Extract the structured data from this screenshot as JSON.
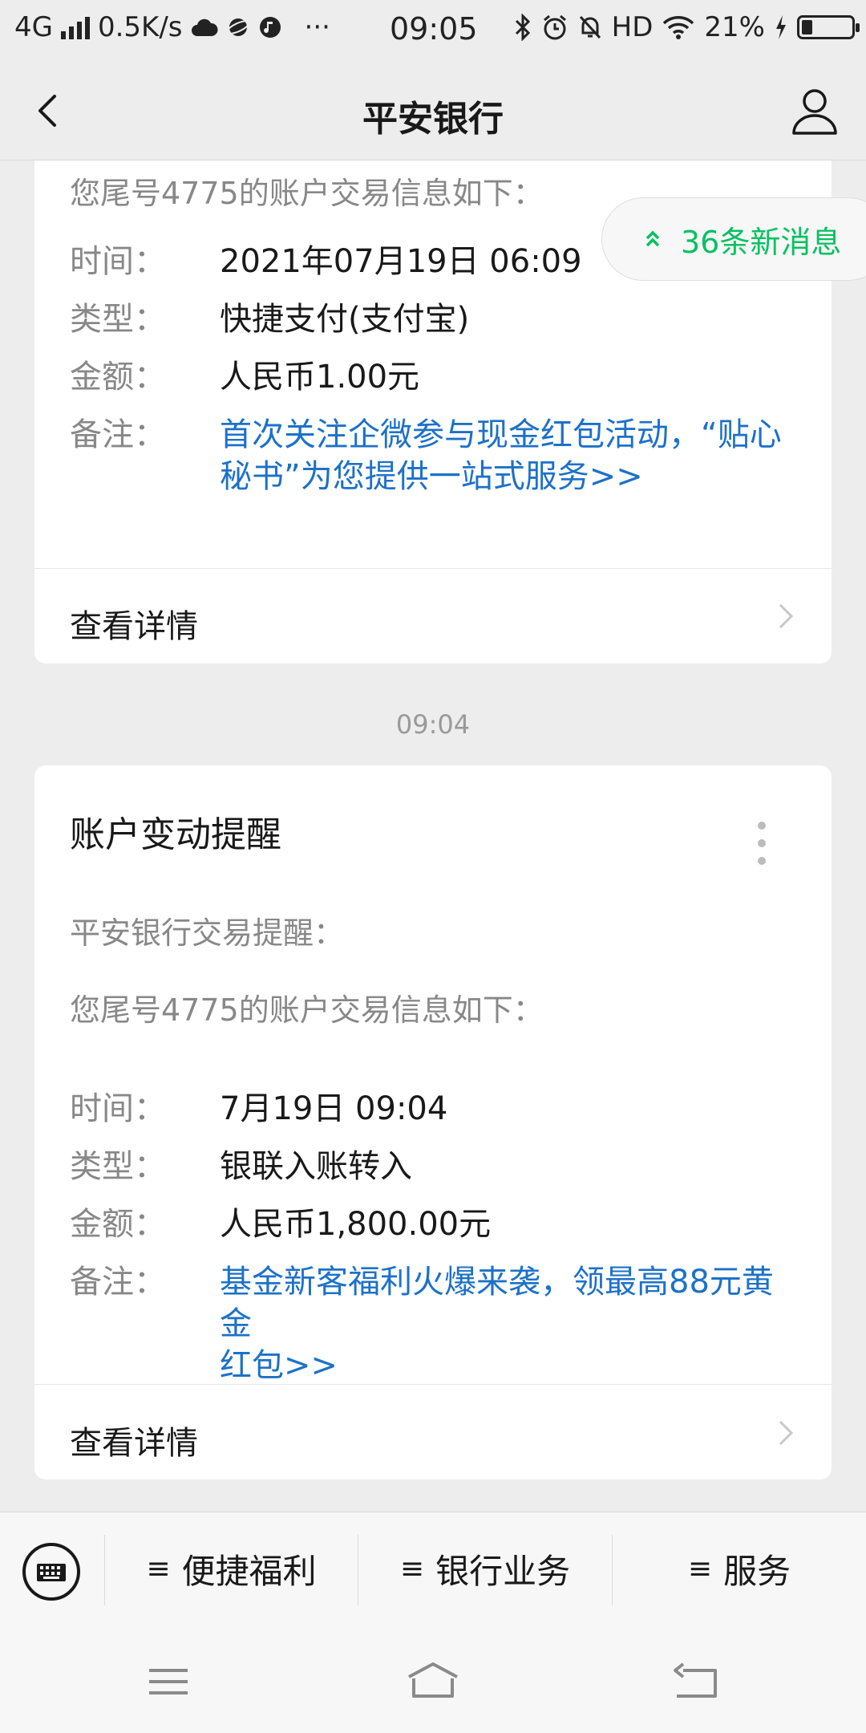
{
  "status_bar": {
    "network": "4G",
    "speed": "0.5K/s",
    "dots": "···",
    "time": "09:05",
    "hd": "HD",
    "battery_percent": "21%",
    "battery_level": 0.21
  },
  "header": {
    "title": "平安银行",
    "back_icon": "chevron-left-icon",
    "profile_icon": "person-icon"
  },
  "new_messages": {
    "label": "36条新消息",
    "icon": "double-chevron-up-icon",
    "color": "#07c160"
  },
  "messages": [
    {
      "intro": "您尾号4775的账户交易信息如下：",
      "rows": [
        {
          "label": "时间：",
          "value": "2021年07月19日 06:09"
        },
        {
          "label": "类型：",
          "value": "快捷支付(支付宝)"
        },
        {
          "label": "金额：",
          "value": "人民币1.00元"
        },
        {
          "label": "备注：",
          "value_line1": "首次关注企微参与现金红包活动，“贴心",
          "value_line2": "秘书”为您提供一站式服务>>"
        }
      ],
      "detail_label": "查看详情"
    },
    {
      "timestamp": "09:04",
      "title": "账户变动提醒",
      "greeting": "平安银行交易提醒：",
      "intro": "您尾号4775的账户交易信息如下：",
      "rows": [
        {
          "label": "时间：",
          "value": "7月19日 09:04"
        },
        {
          "label": "类型：",
          "value": "银联入账转入"
        },
        {
          "label": "金额：",
          "value": "人民币1,800.00元"
        },
        {
          "label": "备注：",
          "value_line1": "基金新客福利火爆来袭，领最高88元黄金",
          "value_line2": "红包>>"
        }
      ],
      "detail_label": "查看详情"
    }
  ],
  "bottom_menu": {
    "keyboard_icon": "keyboard-icon",
    "items": [
      {
        "label": "便捷福利",
        "prefix": "≡"
      },
      {
        "label": "银行业务",
        "prefix": "≡"
      },
      {
        "label": "服务",
        "prefix": "≡"
      }
    ]
  },
  "nav": {
    "menu_icon": "menu-icon",
    "home_icon": "home-icon",
    "back_icon": "back-arrow-icon"
  },
  "colors": {
    "link": "#1d71c8",
    "accent_green": "#07c160",
    "background": "#ededed"
  }
}
